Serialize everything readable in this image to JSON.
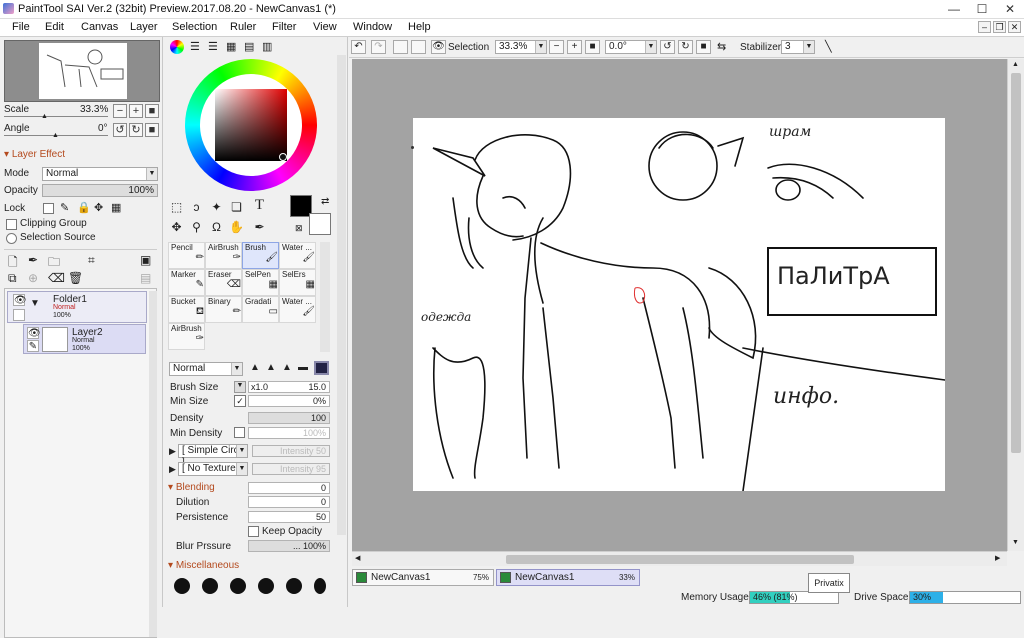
{
  "window": {
    "title": "PaintTool SAI Ver.2 (32bit) Preview.2017.08.20 - NewCanvas1 (*)",
    "minimize": "—",
    "maximize": "☐",
    "close": "✕"
  },
  "menu": [
    "File",
    "Edit",
    "Canvas",
    "Layer",
    "Selection",
    "Ruler",
    "Filter",
    "View",
    "Window",
    "Help"
  ],
  "navigator": {
    "scale_label": "Scale",
    "scale_value": "33.3%",
    "angle_label": "Angle",
    "angle_value": "0°"
  },
  "layer_effect": {
    "header": "Layer Effect",
    "mode_label": "Mode",
    "mode_value": "Normal",
    "opacity_label": "Opacity",
    "opacity_value": "100%",
    "lock_label": "Lock",
    "clipping_group": "Clipping Group",
    "selection_source": "Selection Source"
  },
  "layers": [
    {
      "name": "Folder1",
      "mode": "Normal",
      "opacity": "100%"
    },
    {
      "name": "Layer2",
      "mode": "Normal",
      "opacity": "100%"
    }
  ],
  "tools_row": [
    "☐",
    "↗",
    "✎",
    "❏",
    "T"
  ],
  "tools_row2": [
    "✥",
    "⚲",
    "↻",
    "✒"
  ],
  "brushes": [
    [
      "Pencil",
      "AirBrush",
      "Brush",
      "Water ..."
    ],
    [
      "Marker",
      "Eraser",
      "SelPen",
      "SelErs"
    ],
    [
      "Bucket",
      "Binary",
      "Gradati",
      "Water ..."
    ],
    [
      "AirBrush"
    ]
  ],
  "brush_settings": {
    "blend_mode": "Normal",
    "size_label": "Brush Size",
    "size_mult": "x1.0",
    "size_value": "15.0",
    "minsize_label": "Min Size",
    "minsize_value": "0%",
    "density_label": "Density",
    "density_value": "100",
    "mindensity_label": "Min Density",
    "mindensity_value": "100%",
    "shape": "[ Simple Circle ]",
    "shape_intensity": "Intensity 50",
    "texture": "[ No Texture ]",
    "texture_intensity": "Intensity 95",
    "blending_header": "Blending",
    "blending_value": "0",
    "dilution_label": "Dilution",
    "dilution_value": "0",
    "persistence_label": "Persistence",
    "persistence_value": "50",
    "keep_opacity": "Keep Opacity",
    "blur_label": "Blur Prssure",
    "blur_value": "... 100%",
    "misc_header": "Miscellaneous"
  },
  "toolbar": {
    "selection_label": "Selection",
    "zoom": "33.3%",
    "angle": "0.0°",
    "stabilizer_label": "Stabilizer",
    "stabilizer_value": "3"
  },
  "canvas_text": {
    "t1": "шрам",
    "t2": "ПаЛиТрА",
    "t3": "одежда",
    "t4": "инфо."
  },
  "doc_tabs": [
    {
      "name": "NewCanvas1",
      "zoom": "75%"
    },
    {
      "name": "NewCanvas1",
      "zoom": "33%"
    }
  ],
  "tooltip": "Privatix",
  "status": {
    "memory_label": "Memory Usage",
    "memory_value": "46% (81%)",
    "memory_fraction": 0.46,
    "drive_label": "Drive Space",
    "drive_value": "30%",
    "drive_fraction": 0.3
  }
}
